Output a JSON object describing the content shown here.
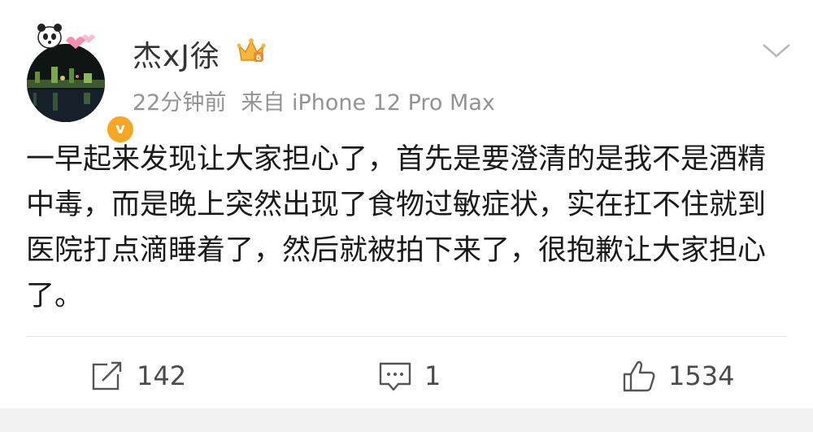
{
  "post": {
    "username": "杰xJ徐",
    "time": "22分钟前",
    "source": "来自 iPhone 12 Pro Max",
    "text": "一早起来发现让大家担心了，首先是要澄清的是我不是酒精中毒，而是晚上突然出现了食物过敏症状，实在扛不住就到医院打点滴睡着了，然后就被拍下来了，很抱歉让大家担心了。"
  },
  "actions": {
    "repost_count": "142",
    "comment_count": "1",
    "like_count": "1534"
  },
  "icons": {
    "verified": "verified-badge-icon",
    "crown": "crown-icon",
    "menu": "chevron-down-icon",
    "repost": "repost-icon",
    "comment": "comment-icon",
    "like": "thumbs-up-icon"
  },
  "colors": {
    "verified": "#f5a623",
    "meta_text": "#939393",
    "body_text": "#1a1a1a"
  }
}
